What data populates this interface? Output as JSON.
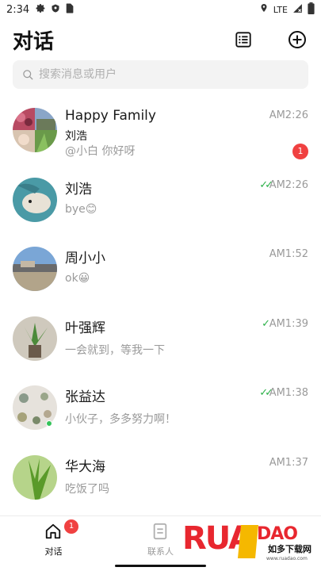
{
  "status": {
    "time": "2:34",
    "network": "LTE"
  },
  "header": {
    "title": "对话"
  },
  "search": {
    "placeholder": "搜索消息或用户"
  },
  "chats": [
    {
      "name": "Happy Family",
      "sub": "刘浩",
      "message": "@小白 你好呀",
      "time": "AM2:26",
      "badge": "1",
      "checks": ""
    },
    {
      "name": "刘浩",
      "sub": "",
      "message": "bye😊",
      "time": "AM2:26",
      "badge": "",
      "checks": "✓✓"
    },
    {
      "name": "周小小",
      "sub": "",
      "message": "ok😀",
      "time": "AM1:52",
      "badge": "",
      "checks": ""
    },
    {
      "name": "叶强辉",
      "sub": "",
      "message": "一会就到，等我一下",
      "time": "AM1:39",
      "badge": "",
      "checks": "✓"
    },
    {
      "name": "张益达",
      "sub": "",
      "message": "小伙子，多多努力啊！",
      "time": "AM1:38",
      "badge": "",
      "checks": "✓✓"
    },
    {
      "name": "华大海",
      "sub": "",
      "message": "吃饭了吗",
      "time": "AM1:37",
      "badge": "",
      "checks": ""
    }
  ],
  "tabs": [
    {
      "label": "对话",
      "badge": "1",
      "active": true
    },
    {
      "label": "联系人",
      "badge": "",
      "active": false
    }
  ],
  "watermark": {
    "brand": "RUANDAO",
    "tagline": "如多下载网",
    "url": "www.ruadao.com"
  },
  "colors": {
    "accent": "#2db14a",
    "badge": "#f04141",
    "muted": "#9a9a9a"
  }
}
